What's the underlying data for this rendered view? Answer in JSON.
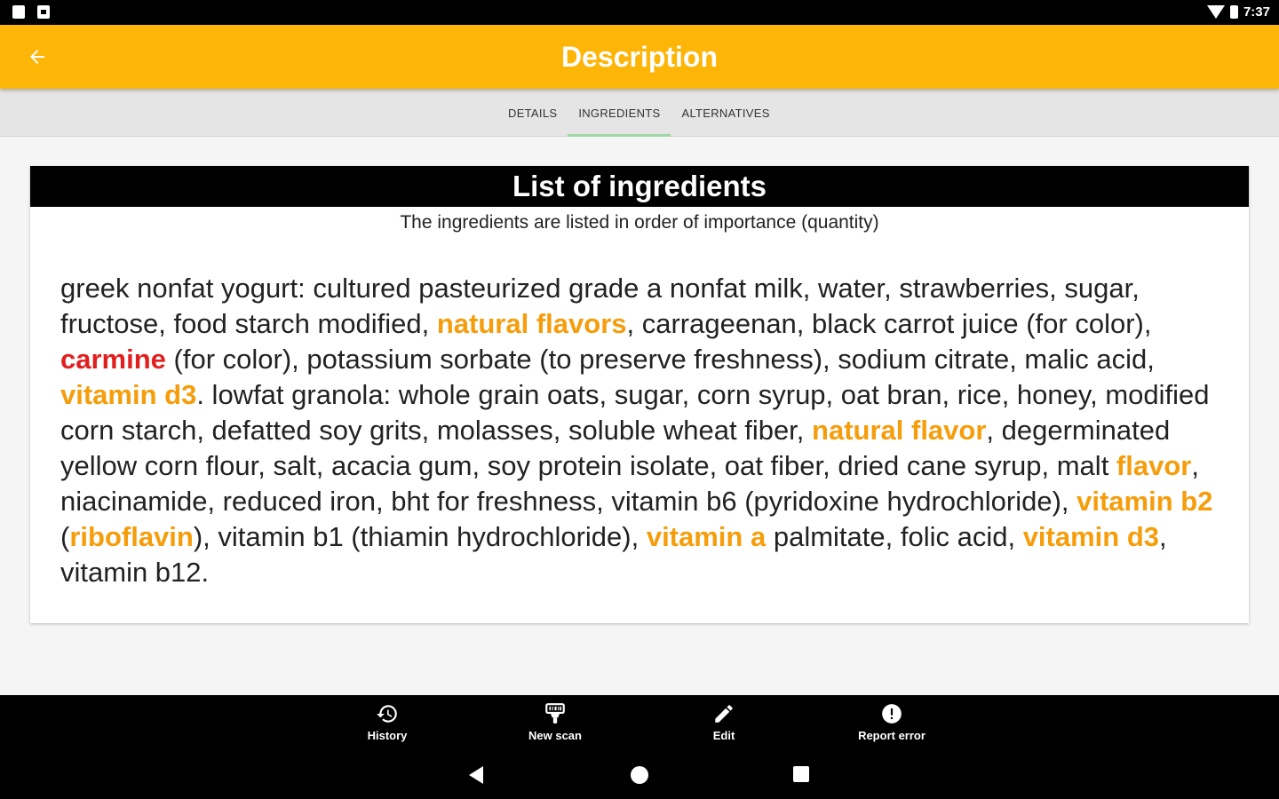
{
  "status_bar": {
    "time": "7:37"
  },
  "app_bar": {
    "title": "Description"
  },
  "tabs": [
    {
      "label": "DETAILS"
    },
    {
      "label": "INGREDIENTS"
    },
    {
      "label": "ALTERNATIVES"
    }
  ],
  "card": {
    "title": "List of ingredients",
    "subtitle": "The ingredients are listed in order of importance (quantity)",
    "ingredients": {
      "t1": "greek nonfat yogurt: cultured pasteurized grade a nonfat milk, water, strawberries, sugar, fructose, food starch modified, ",
      "h1": "natural flavors",
      "t2": ", carrageenan, black carrot juice (for color), ",
      "h2": "carmine",
      "t3": " (for color), potassium sorbate (to preserve freshness), sodium citrate, malic acid, ",
      "h3": "vitamin d3",
      "t4": ". lowfat granola: whole grain oats, sugar, corn syrup, oat bran, rice, honey, modified corn starch, defatted soy grits, molasses, soluble wheat fiber, ",
      "h4": "natural flavor",
      "t5": ", degerminated yellow corn flour, salt, acacia gum, soy protein isolate, oat fiber, dried cane syrup, malt ",
      "h5": "flavor",
      "t6": ", niacinamide, reduced iron, bht for freshness, vitamin b6 (pyridoxine hydrochloride), ",
      "h6": "vitamin b2",
      "t7": " (",
      "h7": "riboflavin",
      "t8": "), vitamin b1 (thiamin hydrochloride), ",
      "h8": "vitamin a",
      "t9": " palmitate, folic acid, ",
      "h9": "vitamin d3",
      "t10": ", vitamin b12."
    }
  },
  "bottom_nav": [
    {
      "label": "History",
      "icon": "history-icon"
    },
    {
      "label": "New scan",
      "icon": "barcode-scan-icon"
    },
    {
      "label": "Edit",
      "icon": "pencil-icon"
    },
    {
      "label": "Report error",
      "icon": "alert-circle-icon"
    }
  ],
  "colors": {
    "app_bar": "#fdb508",
    "highlight_orange": "#f59d0b",
    "highlight_red": "#e11f1f",
    "tab_indicator": "#9fd8a5"
  }
}
